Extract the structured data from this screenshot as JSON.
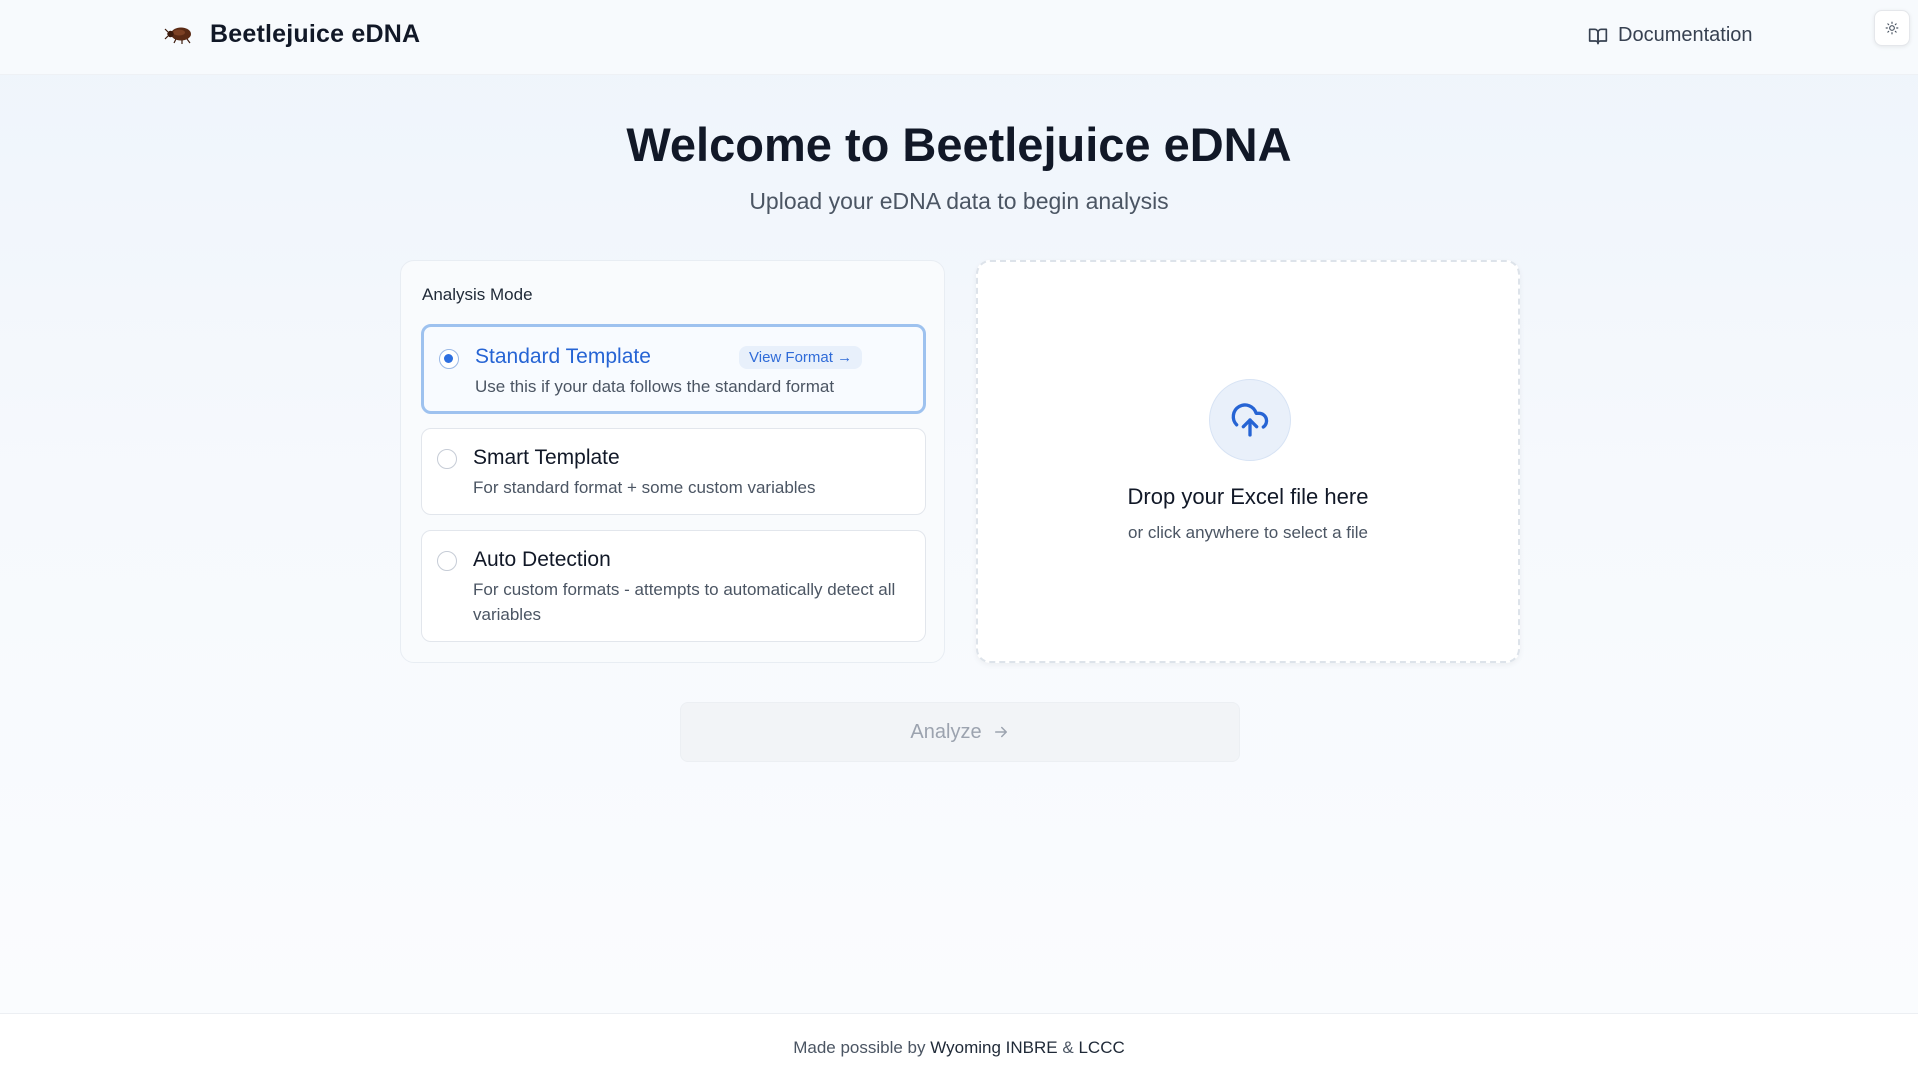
{
  "header": {
    "app_title": "Beetlejuice eDNA",
    "logo_icon": "beetle-icon",
    "docs_label": "Documentation",
    "docs_icon": "book-open-icon",
    "theme_icon": "sun-icon"
  },
  "hero": {
    "title": "Welcome to Beetlejuice eDNA",
    "subtitle": "Upload your eDNA data to begin analysis"
  },
  "analysis_mode": {
    "heading": "Analysis Mode",
    "options": [
      {
        "title": "Standard Template",
        "description": "Use this if your data follows the standard format",
        "selected": true,
        "link_label": "View Format →"
      },
      {
        "title": "Smart Template",
        "description": "For standard format + some custom variables",
        "selected": false
      },
      {
        "title": "Auto Detection",
        "description": "For custom formats - attempts to automatically detect all variables",
        "selected": false
      }
    ]
  },
  "dropzone": {
    "icon": "cloud-upload-icon",
    "title": "Drop your Excel file here",
    "subtitle": "or click anywhere to select a file"
  },
  "analyze": {
    "label": "Analyze",
    "icon": "arrow-right-icon",
    "disabled": true
  },
  "footer": {
    "prefix": "Made possible by",
    "link1": "Wyoming INBRE",
    "separator": "&",
    "link2": "LCCC"
  },
  "colors": {
    "accent": "#2664d4",
    "selected_border": "#9ec2ef",
    "disabled_text": "#9ca3af"
  }
}
